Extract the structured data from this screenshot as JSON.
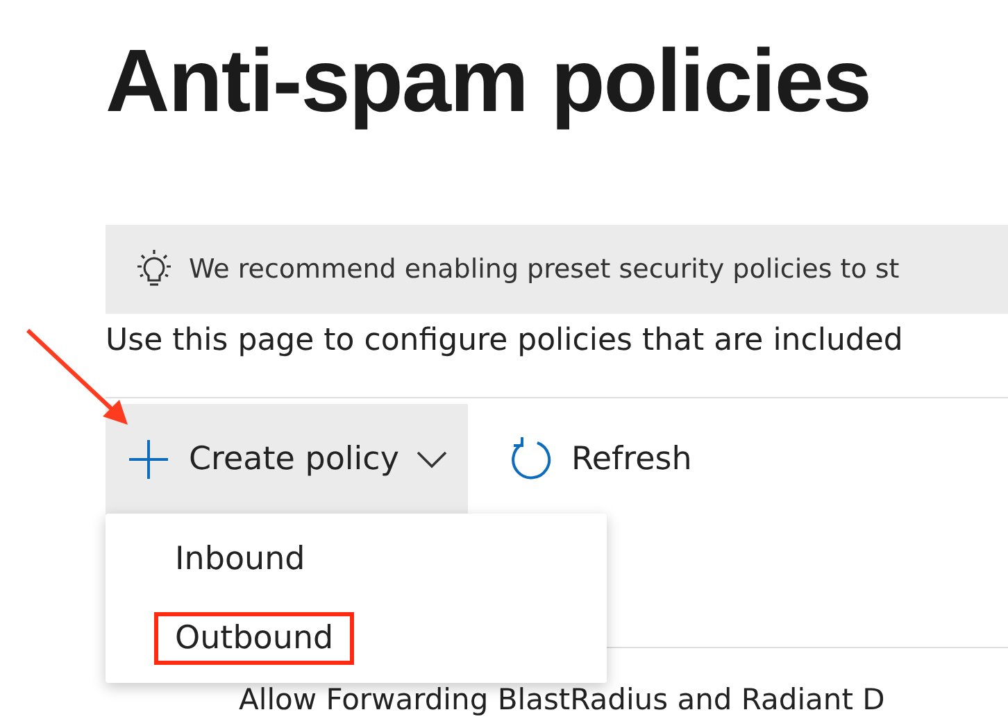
{
  "title": "Anti-spam policies",
  "banner": {
    "text": "We recommend enabling preset security policies to st"
  },
  "description": "Use this page to configure policies that are included",
  "toolbar": [
    {
      "kind": "create",
      "label": "Create policy",
      "expanded": true
    },
    {
      "kind": "refresh",
      "label": "Refresh"
    }
  ],
  "dropdown": [
    {
      "label": "Inbound",
      "highlighted": false
    },
    {
      "label": "Outbound",
      "highlighted": true
    }
  ],
  "rows": [
    {
      "name": "Allow Forwarding BlastRadius and Radiant D"
    }
  ]
}
